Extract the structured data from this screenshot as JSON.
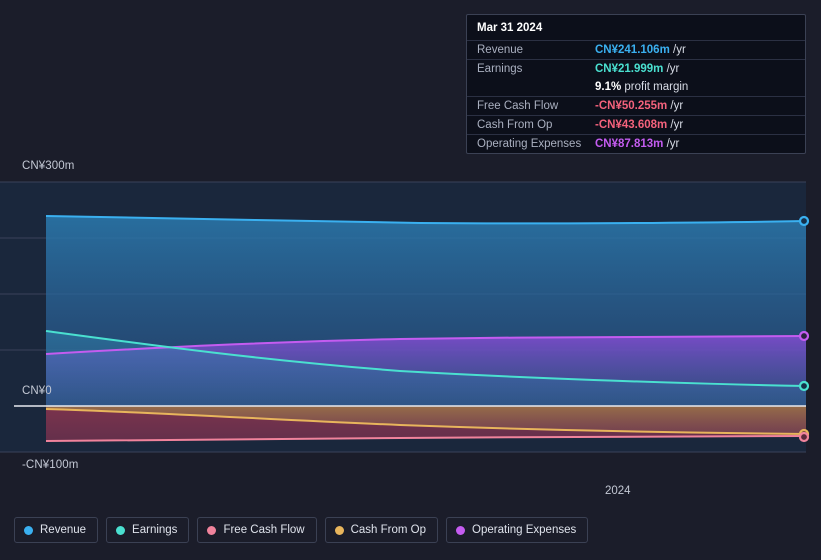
{
  "axis": {
    "y_top_label": "CN¥300m",
    "y_zero_label": "CN¥0",
    "y_bottom_label": "-CN¥100m",
    "x_label": "2024"
  },
  "tooltip": {
    "date": "Mar 31 2024",
    "rows": [
      {
        "key": "Revenue",
        "value": "CN¥241.106m",
        "unit": " /yr",
        "color": "#3ab0f0"
      },
      {
        "key": "Earnings",
        "value": "CN¥21.999m",
        "unit": " /yr",
        "color": "#4ae0d0"
      },
      {
        "key": "",
        "value": "9.1%",
        "unit": " profit margin",
        "color": "#ffffff"
      },
      {
        "key": "Free Cash Flow",
        "value": "-CN¥50.255m",
        "unit": " /yr",
        "color": "#f4627c"
      },
      {
        "key": "Cash From Op",
        "value": "-CN¥43.608m",
        "unit": " /yr",
        "color": "#f4627c"
      },
      {
        "key": "Operating Expenses",
        "value": "CN¥87.813m",
        "unit": " /yr",
        "color": "#c45cf0"
      }
    ]
  },
  "legend": [
    {
      "label": "Revenue",
      "color": "#3ab0f0"
    },
    {
      "label": "Earnings",
      "color": "#4ae0d0"
    },
    {
      "label": "Free Cash Flow",
      "color": "#f0839c"
    },
    {
      "label": "Cash From Op",
      "color": "#e8b55c"
    },
    {
      "label": "Operating Expenses",
      "color": "#c45cf0"
    }
  ],
  "chart_data": {
    "type": "area",
    "title": "",
    "xlabel": "2024",
    "ylabel": "CN¥",
    "ylim": [
      -100000000,
      300000000
    ],
    "yticks": [
      300000000,
      0,
      -100000000
    ],
    "ytick_labels": [
      "CN¥300m",
      "CN¥0",
      "-CN¥100m"
    ],
    "grid": true,
    "legend_position": "bottom-left",
    "highlight_date": "Mar 31 2024",
    "x": [
      "start",
      "2024",
      "Mar 31 2024"
    ],
    "series": [
      {
        "name": "Revenue",
        "color": "#3ab0f0",
        "end_value": 241106000,
        "values_approx": [
          258000000,
          248000000,
          241106000
        ]
      },
      {
        "name": "Earnings",
        "color": "#4ae0d0",
        "end_value": 21999000,
        "values_approx": [
          74000000,
          40000000,
          21999000
        ]
      },
      {
        "name": "Free Cash Flow",
        "color": "#f0839c",
        "end_value": -50255000,
        "values_approx": [
          -77000000,
          -72000000,
          -50255000
        ]
      },
      {
        "name": "Cash From Op",
        "color": "#e8b55c",
        "end_value": -43608000,
        "values_approx": [
          -12000000,
          -38000000,
          -43608000
        ]
      },
      {
        "name": "Operating Expenses",
        "color": "#c45cf0",
        "end_value": 87813000,
        "values_approx": [
          59000000,
          82000000,
          87813000
        ]
      }
    ]
  }
}
